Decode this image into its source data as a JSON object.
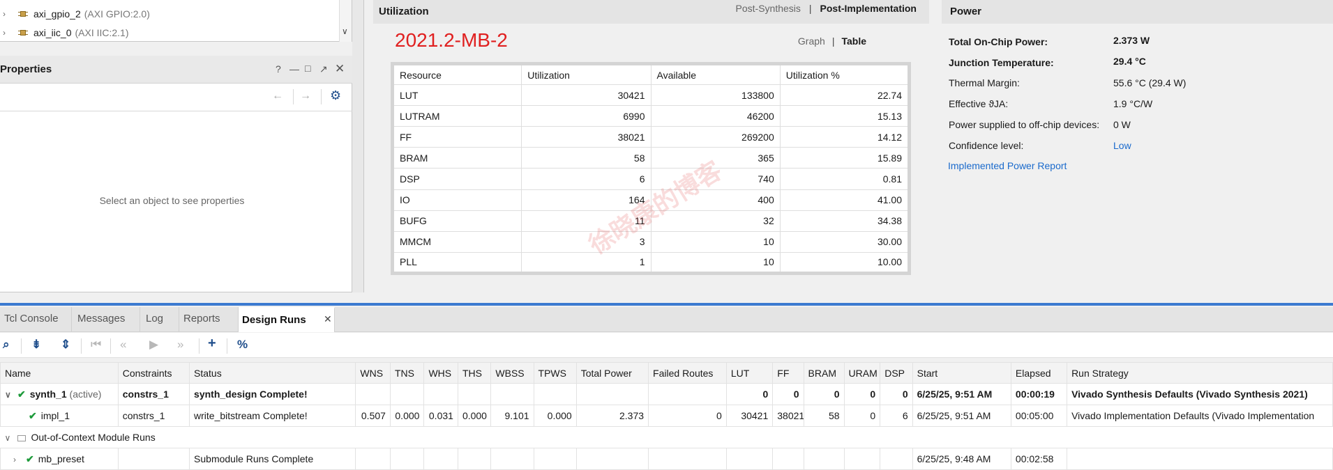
{
  "tree": {
    "items": [
      {
        "name": "axi_gpio_2",
        "detail": "(AXI GPIO:2.0)"
      },
      {
        "name": "axi_iic_0",
        "detail": "(AXI IIC:2.1)"
      }
    ]
  },
  "properties": {
    "title": "Properties",
    "header_icons": [
      "help-icon",
      "minimize-icon",
      "maximize-icon",
      "float-icon",
      "close-icon"
    ],
    "empty_message": "Select an object to see properties"
  },
  "utilization": {
    "title": "Utilization",
    "mode_options": [
      "Post-Synthesis",
      "Post-Implementation"
    ],
    "mode_selected": "Post-Implementation",
    "design_name": "2021.2-MB-2",
    "view_options": [
      "Graph",
      "Table"
    ],
    "view_selected": "Table",
    "columns": [
      "Resource",
      "Utilization",
      "Available",
      "Utilization %"
    ],
    "rows": [
      [
        "LUT",
        "30421",
        "133800",
        "22.74"
      ],
      [
        "LUTRAM",
        "6990",
        "46200",
        "15.13"
      ],
      [
        "FF",
        "38021",
        "269200",
        "14.12"
      ],
      [
        "BRAM",
        "58",
        "365",
        "15.89"
      ],
      [
        "DSP",
        "6",
        "740",
        "0.81"
      ],
      [
        "IO",
        "164",
        "400",
        "41.00"
      ],
      [
        "BUFG",
        "11",
        "32",
        "34.38"
      ],
      [
        "MMCM",
        "3",
        "10",
        "30.00"
      ],
      [
        "PLL",
        "1",
        "10",
        "10.00"
      ]
    ],
    "watermark": "徐晓康的博客"
  },
  "power": {
    "title": "Power",
    "rows": [
      {
        "label": "Total On-Chip Power:",
        "value": "2.373 W",
        "bold": true
      },
      {
        "label": "Junction Temperature:",
        "value": "29.4 °C",
        "bold": true
      },
      {
        "label": "Thermal Margin:",
        "value": "55.6 °C (29.4 W)",
        "bold": false
      },
      {
        "label": "Effective ϑJA:",
        "value": "1.9 °C/W",
        "bold": false
      },
      {
        "label": "Power supplied to off-chip devices:",
        "value": "0 W",
        "bold": false
      },
      {
        "label": "Confidence level:",
        "value": "Low",
        "bold": false
      }
    ],
    "report_link": "Implemented Power Report"
  },
  "bottom_tabs": [
    "Tcl Console",
    "Messages",
    "Log",
    "Reports",
    "Design Runs"
  ],
  "active_tab": "Design Runs",
  "toolbar_icons": [
    "search-icon",
    "collapse-all-icon",
    "expand-all-icon",
    "first-icon",
    "previous-icon",
    "run-icon",
    "next-icon",
    "add-icon",
    "percent-icon"
  ],
  "runs": {
    "columns": [
      "Name",
      "Constraints",
      "Status",
      "WNS",
      "TNS",
      "WHS",
      "THS",
      "WBSS",
      "TPWS",
      "Total Power",
      "Failed Routes",
      "LUT",
      "FF",
      "BRAM",
      "URAM",
      "DSP",
      "Start",
      "Elapsed",
      "Run Strategy"
    ],
    "synth": {
      "name": "synth_1",
      "tag": "(active)",
      "constraints": "constrs_1",
      "status": "synth_design Complete!",
      "lut": "0",
      "ff": "0",
      "bram": "0",
      "uram": "0",
      "dsp": "0",
      "start": "6/25/25, 9:51 AM",
      "elapsed": "00:00:19",
      "strategy": "Vivado Synthesis Defaults (Vivado Synthesis 2021)"
    },
    "impl": {
      "name": "impl_1",
      "constraints": "constrs_1",
      "status": "write_bitstream Complete!",
      "wns": "0.507",
      "tns": "0.000",
      "whs": "0.031",
      "ths": "0.000",
      "wbss": "9.101",
      "tpws": "0.000",
      "total_power": "2.373",
      "failed_routes": "0",
      "lut": "30421",
      "ff": "38021",
      "bram": "58",
      "uram": "0",
      "dsp": "6",
      "start": "6/25/25, 9:51 AM",
      "elapsed": "00:05:00",
      "strategy": "Vivado Implementation Defaults (Vivado Implementation"
    },
    "ooc_label": "Out-of-Context Module Runs",
    "preset": {
      "name": "mb_preset",
      "status": "Submodule Runs Complete",
      "start": "6/25/25, 9:48 AM",
      "elapsed": "00:02:58"
    }
  }
}
